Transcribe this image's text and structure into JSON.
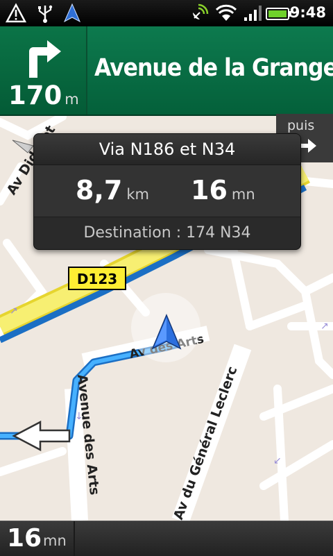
{
  "status_bar": {
    "time": "9:48",
    "icons": [
      "warning-icon",
      "usb-icon",
      "navigation-arrow-icon",
      "gps-icon",
      "wifi-icon",
      "signal-icon",
      "battery-icon"
    ]
  },
  "navigation": {
    "turn_direction": "turn-right-icon",
    "distance_value": "170",
    "distance_unit": "m",
    "street_name": "Avenue de la Grange"
  },
  "popup": {
    "via": "Via N186 et N34",
    "distance_value": "8,7",
    "distance_unit": "km",
    "time_value": "16",
    "time_unit": "mn",
    "destination": "Destination : 174 N34"
  },
  "next_step": {
    "label": "puis",
    "icon": "arrow-right-icon"
  },
  "map": {
    "road_badge": "D123",
    "labels": {
      "av_diderot": "Av Diderot",
      "av_des_arts": "Av des Arts",
      "avenue_des_arts": "Avenue des Arts",
      "general_leclerc": "Av du Général Leclerc"
    }
  },
  "bottom_bar": {
    "time_value": "16",
    "time_unit": "mn"
  },
  "colors": {
    "header_green": "#0b7447",
    "route_blue": "#3aa2e8",
    "highway_yellow": "#f5e73a",
    "map_background": "#efe8e0"
  }
}
